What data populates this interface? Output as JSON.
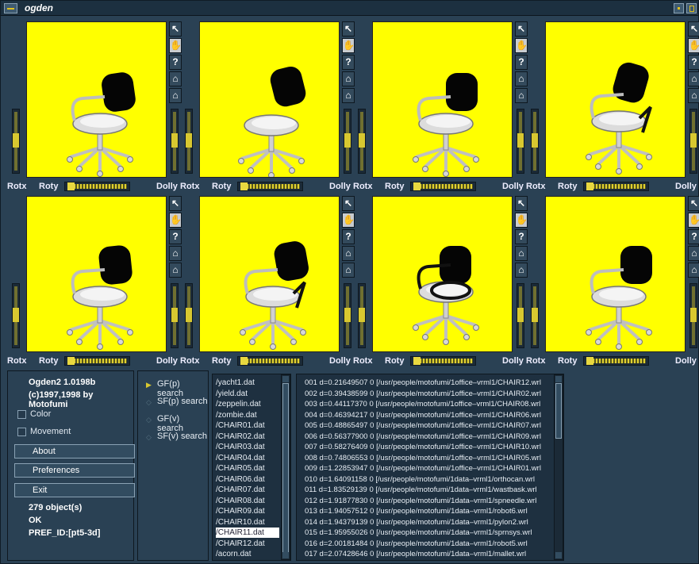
{
  "window": {
    "title": "ogden"
  },
  "viewers": [
    {
      "rotx": "Rotx",
      "roty": "Roty",
      "dolly": "Dolly"
    },
    {
      "rotx": "Rotx",
      "roty": "Roty",
      "dolly": "Dolly"
    },
    {
      "rotx": "Rotx",
      "roty": "Roty",
      "dolly": "Dolly"
    },
    {
      "rotx": "Rotx",
      "roty": "Roty",
      "dolly": "Dolly"
    },
    {
      "rotx": "Rotx",
      "roty": "Roty",
      "dolly": "Dolly"
    },
    {
      "rotx": "Rotx",
      "roty": "Roty",
      "dolly": "Dolly"
    },
    {
      "rotx": "Rotx",
      "roty": "Roty",
      "dolly": "Dolly"
    },
    {
      "rotx": "Rotx",
      "roty": "Roty",
      "dolly": "Dolly"
    }
  ],
  "tools": {
    "pick": "arrow-pointer-icon",
    "view": "hand-icon",
    "help": "?",
    "home": "home-icon",
    "set_home": "set-home-icon"
  },
  "info": {
    "app_name": "Ogden2  1.0198b",
    "copyright": "(c)1997,1998 by Motofumi",
    "color_label": "Color",
    "movement_label": "Movement",
    "about_label": "About",
    "preferences_label": "Preferences",
    "exit_label": "Exit",
    "object_count": "279 object(s)",
    "status": "OK",
    "pref_id": "PREF_ID:[pt5-3d]"
  },
  "search": {
    "options": [
      {
        "label": "GF(p) search",
        "selected": true
      },
      {
        "label": "SF(p) search",
        "selected": false
      },
      {
        "label": "GF(v) search",
        "selected": false
      },
      {
        "label": "SF(v) search",
        "selected": false
      }
    ]
  },
  "files": {
    "items": [
      "/yacht1.dat",
      "/yield.dat",
      "/zeppelin.dat",
      "/zombie.dat",
      "/CHAIR01.dat",
      "/CHAIR02.dat",
      "/CHAIR03.dat",
      "/CHAIR04.dat",
      "/CHAIR05.dat",
      "/CHAIR06.dat",
      "/CHAIR07.dat",
      "/CHAIR08.dat",
      "/CHAIR09.dat",
      "/CHAIR10.dat",
      "/CHAIR11.dat",
      "/CHAIR12.dat",
      "/acorn.dat"
    ],
    "selected_index": 14
  },
  "results": {
    "items": [
      "001 d=0.21649507 0 [/usr/people/motofumi/1office–vrml1/CHAIR12.wrl",
      "002 d=0.39438599 0 [/usr/people/motofumi/1office–vrml1/CHAIR02.wrl",
      "003 d=0.44117370 0 [/usr/people/motofumi/1office–vrml1/CHAIR08.wrl",
      "004 d=0.46394217 0 [/usr/people/motofumi/1office–vrml1/CHAIR06.wrl",
      "005 d=0.48865497 0 [/usr/people/motofumi/1office–vrml1/CHAIR07.wrl",
      "006 d=0.56377900 0 [/usr/people/motofumi/1office–vrml1/CHAIR09.wrl",
      "007 d=0.58276409 0 [/usr/people/motofumi/1office–vrml1/CHAIR10.wrl",
      "008 d=0.74806553 0 [/usr/people/motofumi/1office–vrml1/CHAIR05.wrl",
      "009 d=1.22853947 0 [/usr/people/motofumi/1office–vrml1/CHAIR01.wrl",
      "010 d=1.64091158 0 [/usr/people/motofumi/1data–vrml1/orthocan.wrl",
      "011 d=1.83529139 0 [/usr/people/motofumi/1data–vrml1/wastbask.wrl",
      "012 d=1.91877830 0 [/usr/people/motofumi/1data–vrml1/spneedle.wrl",
      "013 d=1.94057512 0 [/usr/people/motofumi/1data–vrml1/robot6.wrl",
      "014 d=1.94379139 0 [/usr/people/motofumi/1data–vrml1/pylon2.wrl",
      "015 d=1.95955026 0 [/usr/people/motofumi/1data–vrml1/sprnsys.wrl",
      "016 d=2.00181484 0 [/usr/people/motofumi/1data–vrml1/robot5.wrl",
      "017 d=2.07428646 0 [/usr/people/motofumi/1data–vrml1/mallet.wrl"
    ]
  },
  "colors": {
    "viewport": "#ffff00",
    "panel": "#2a4154",
    "accent": "#d8c830"
  }
}
